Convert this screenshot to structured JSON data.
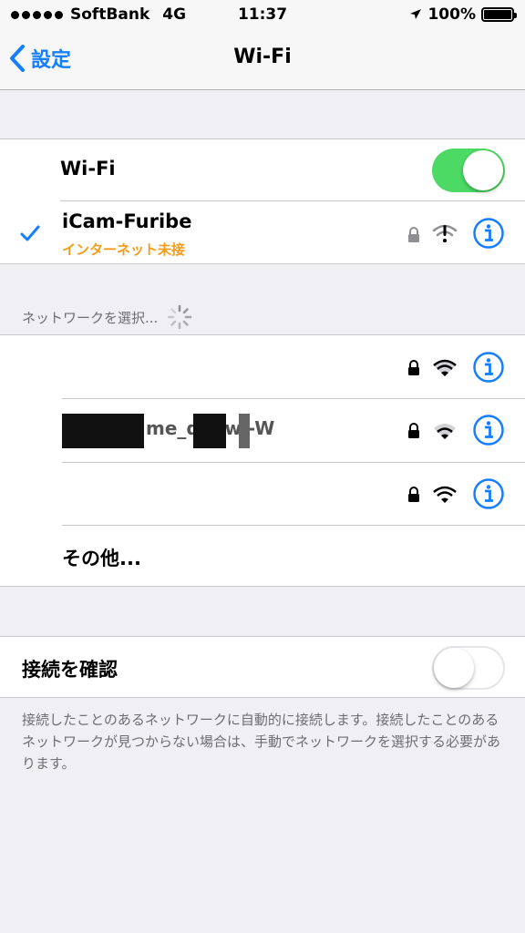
{
  "status_bar": {
    "carrier": "SoftBank",
    "network": "4G",
    "time": "11:37",
    "battery": "100%",
    "battery_level": 1.0,
    "icons": [
      "signal-dots-icon",
      "location-arrow-icon",
      "battery-icon"
    ]
  },
  "nav": {
    "back_label": "設定",
    "title": "Wi-Fi"
  },
  "wifi_toggle": {
    "label": "Wi-Fi",
    "state": "on"
  },
  "connected_network": {
    "name": "iCam-Furibe",
    "status": "インターネット未接",
    "icons": [
      "checkmark-icon",
      "lock-icon",
      "wifi-warning-icon",
      "info-icon"
    ]
  },
  "network_section": {
    "header": "ネットワークを選択..."
  },
  "networks": [
    {
      "name": "",
      "secured": true
    },
    {
      "name": "me_d88wj-W",
      "secured": true
    },
    {
      "name": "",
      "secured": true
    }
  ],
  "other_label": "その他...",
  "ask_to_join": {
    "label": "接続を確認",
    "state": "off"
  },
  "footer_note": "接続したことのあるネットワークに自動的に接続します。接続したことのあるネットワークが見つからない場合は、手動でネットワークを選択する必要があります。",
  "colors": {
    "accent": "#157efb",
    "toggle_on": "#4cd964",
    "warning_text": "#f49b1a",
    "background": "#efeff4"
  }
}
